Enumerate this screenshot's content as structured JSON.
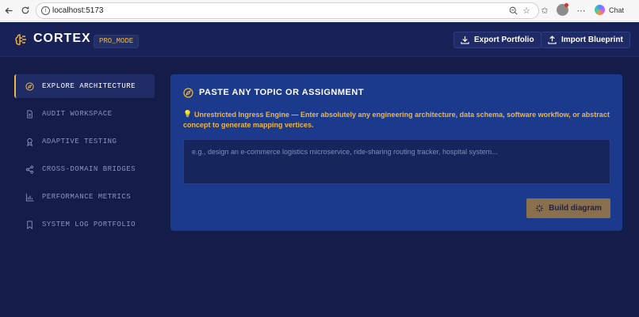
{
  "browser": {
    "url": "localhost:5173",
    "chat_label": "Chat"
  },
  "header": {
    "brand": "CORTEX",
    "badge": "PRO_MODE",
    "export_label": "Export Portfolio",
    "import_label": "Import Blueprint"
  },
  "sidebar": {
    "items": [
      {
        "label": "EXPLORE ARCHITECTURE",
        "icon": "compass-icon",
        "active": true
      },
      {
        "label": "AUDIT WORKSPACE",
        "icon": "document-icon",
        "active": false
      },
      {
        "label": "ADAPTIVE TESTING",
        "icon": "award-icon",
        "active": false
      },
      {
        "label": "CROSS-DOMAIN BRIDGES",
        "icon": "share-icon",
        "active": false
      },
      {
        "label": "PERFORMANCE METRICS",
        "icon": "bar-chart-icon",
        "active": false
      },
      {
        "label": "SYSTEM LOG PORTFOLIO",
        "icon": "bookmark-icon",
        "active": false
      }
    ]
  },
  "main": {
    "title": "PASTE ANY TOPIC OR ASSIGNMENT",
    "notice": "Unrestricted Ingress Engine — Enter absolutely any engineering architecture, data schema, software workflow, or abstract concept to generate mapping vertices.",
    "input_placeholder": "e.g., design an e-commerce logistics microservice, ride-sharing routing tracker, hospital system...",
    "input_value": "",
    "build_label": "Build diagram"
  },
  "colors": {
    "accent": "#f0b545",
    "app_bg": "#141c4a",
    "panel_bg": "#1c3a8c",
    "build_button": "#8a6f4f"
  }
}
